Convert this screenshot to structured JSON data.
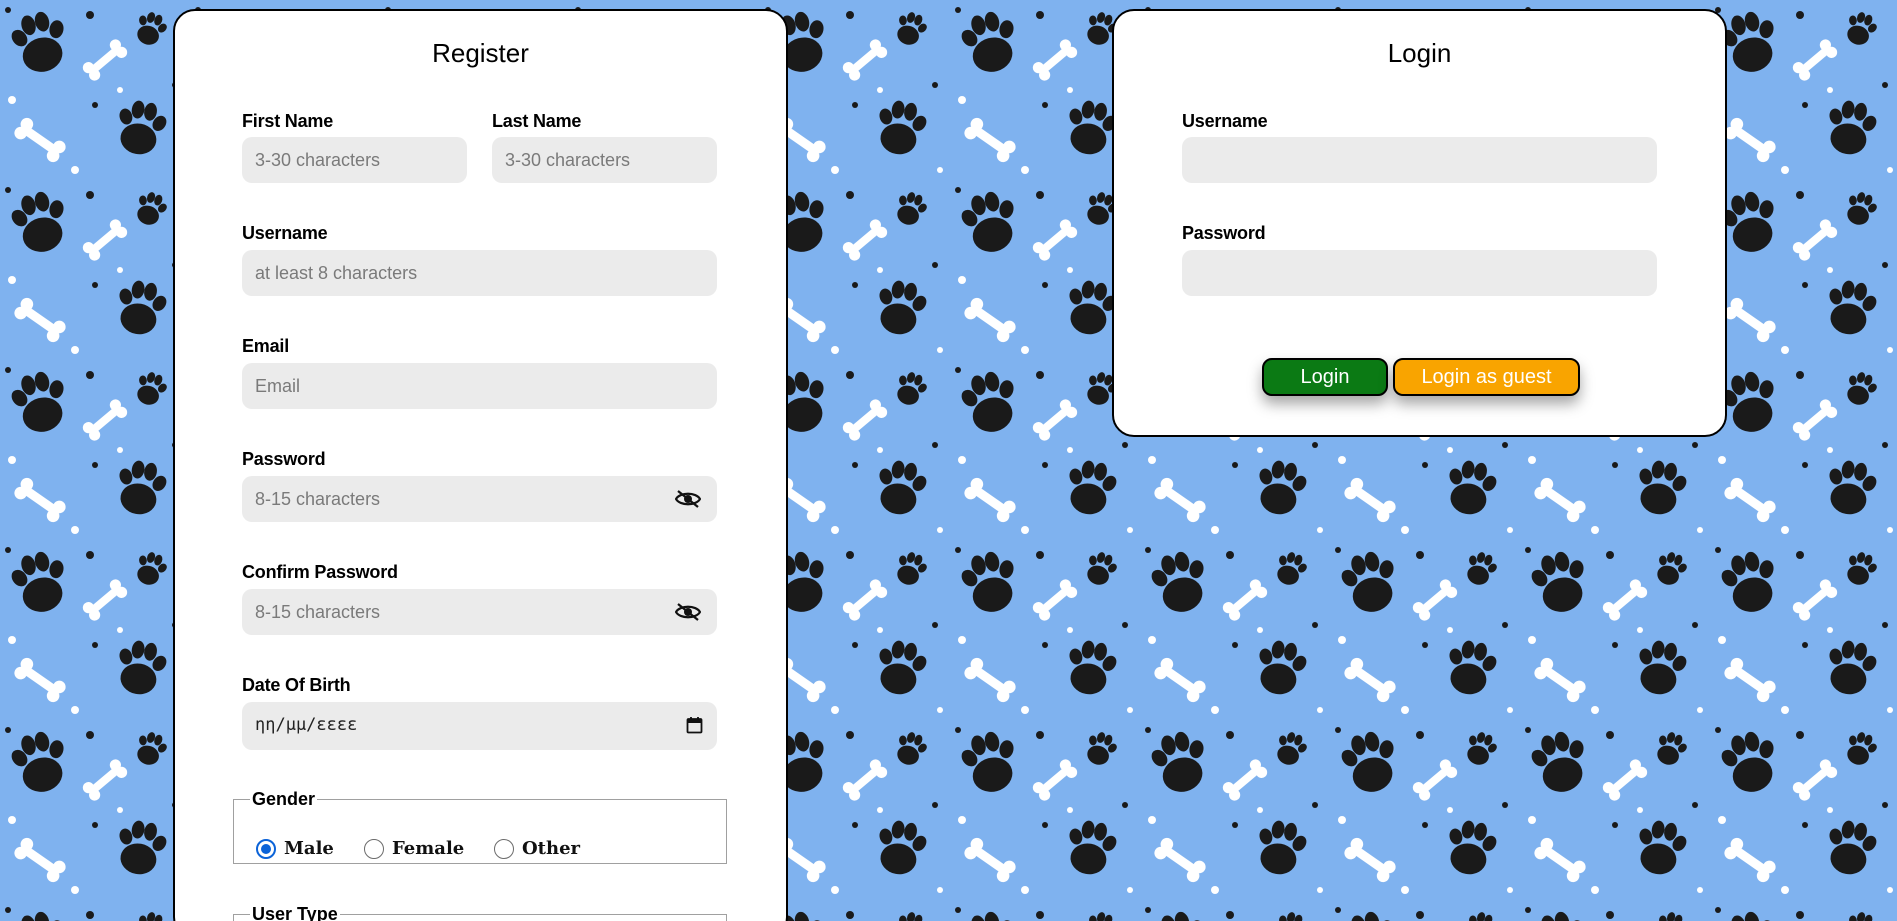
{
  "colors": {
    "background": "#7fb2ef",
    "card": "#ffffff",
    "input_bg": "#ebebeb",
    "login_button": "#0b7a14",
    "guest_button": "#f9a400",
    "radio_accent": "#0b63d8"
  },
  "register": {
    "title": "Register",
    "first_name": {
      "label": "First Name",
      "placeholder": "3-30 characters"
    },
    "last_name": {
      "label": "Last Name",
      "placeholder": "3-30 characters"
    },
    "username": {
      "label": "Username",
      "placeholder": "at least 8 characters"
    },
    "email": {
      "label": "Email",
      "placeholder": "Email"
    },
    "password": {
      "label": "Password",
      "placeholder": "8-15 characters",
      "icon": "eye-slash-icon"
    },
    "confirm_password": {
      "label": "Confirm Password",
      "placeholder": "8-15 characters",
      "icon": "eye-slash-icon"
    },
    "date_of_birth": {
      "label": "Date Of Birth",
      "value": "ηη/μμ/εεεε",
      "icon": "calendar-icon"
    },
    "gender": {
      "legend": "Gender",
      "options": [
        "Male",
        "Female",
        "Other"
      ],
      "selected": "Male"
    },
    "user_type": {
      "legend": "User Type"
    }
  },
  "login": {
    "title": "Login",
    "username": {
      "label": "Username",
      "placeholder": ""
    },
    "password": {
      "label": "Password",
      "placeholder": ""
    },
    "login_button": "Login",
    "guest_button": "Login as guest"
  }
}
